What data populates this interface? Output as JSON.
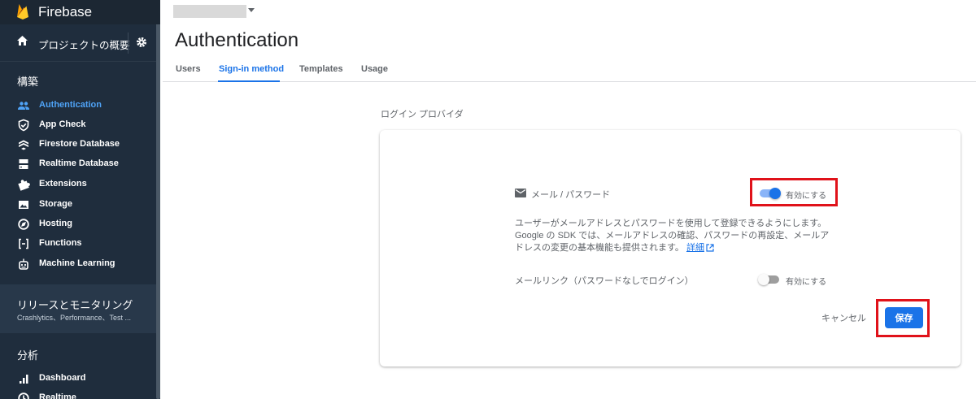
{
  "app": {
    "brand_name": "Firebase"
  },
  "sidebar": {
    "overview_label": "プロジェクトの概要",
    "build_section": "構築",
    "items": [
      {
        "label": "Authentication",
        "icon": "people-icon",
        "active": true
      },
      {
        "label": "App Check",
        "icon": "shield-check-icon",
        "active": false
      },
      {
        "label": "Firestore Database",
        "icon": "firestore-icon",
        "active": false
      },
      {
        "label": "Realtime Database",
        "icon": "database-icon",
        "active": false
      },
      {
        "label": "Extensions",
        "icon": "puzzle-icon",
        "active": false
      },
      {
        "label": "Storage",
        "icon": "image-icon",
        "active": false
      },
      {
        "label": "Hosting",
        "icon": "globe-icon",
        "active": false
      },
      {
        "label": "Functions",
        "icon": "functions-icon",
        "active": false
      },
      {
        "label": "Machine Learning",
        "icon": "robot-icon",
        "active": false
      }
    ],
    "release_title": "リリースとモニタリング",
    "release_subtitle": "Crashlytics、Performance、Test ...",
    "analytics_section": "分析",
    "analytics_items": [
      {
        "label": "Dashboard",
        "icon": "bar-chart-icon"
      },
      {
        "label": "Realtime",
        "icon": "clock-icon"
      }
    ]
  },
  "header": {
    "page_title": "Authentication",
    "tabs": [
      {
        "label": "Users",
        "active": false
      },
      {
        "label": "Sign-in method",
        "active": true
      },
      {
        "label": "Templates",
        "active": false
      },
      {
        "label": "Usage",
        "active": false
      }
    ]
  },
  "providers": {
    "section_label": "ログイン プロバイダ",
    "email_password_label": "メール / パスワード",
    "email_password_toggle_label": "有効にする",
    "email_password_enabled": true,
    "description_text": "ユーザーがメールアドレスとパスワードを使用して登録できるようにします。Google の SDK では、メールアドレスの確認、パスワードの再設定、メールアドレスの変更の基本機能も提供されます。",
    "details_link": "詳細",
    "email_link_label": "メールリンク（パスワードなしでログイン）",
    "email_link_toggle_label": "有効にする",
    "email_link_enabled": false
  },
  "actions": {
    "cancel_label": "キャンセル",
    "save_label": "保存"
  },
  "colors": {
    "sidebar_bg": "#1f2d3d",
    "accent": "#1a73e8",
    "highlight": "#e0121a"
  }
}
